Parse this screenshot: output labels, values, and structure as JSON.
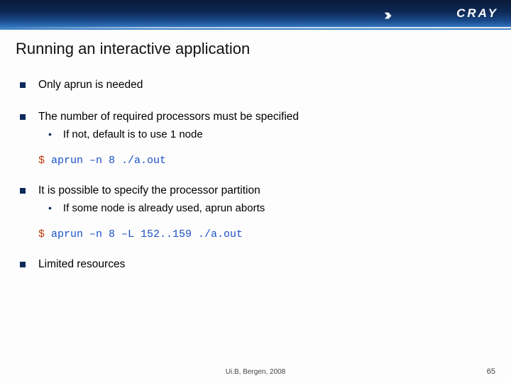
{
  "logo": "CRAY",
  "title": "Running an interactive application",
  "bullets": [
    {
      "text": "Only aprun is needed"
    },
    {
      "text": "The number of required processors must be specified",
      "sub": "If not, default is to use 1 node",
      "code_prompt": "$ ",
      "code_cmd": "aprun –n 8 ./a.out"
    },
    {
      "text": "It is possible to specify the processor partition",
      "sub": "If some node is already used, aprun aborts",
      "code_prompt": "$ ",
      "code_cmd": "aprun –n 8 –L 152..159 ./a.out"
    },
    {
      "text": "Limited resources"
    }
  ],
  "footer": "Ui.B, Bergen, 2008",
  "page": "65"
}
